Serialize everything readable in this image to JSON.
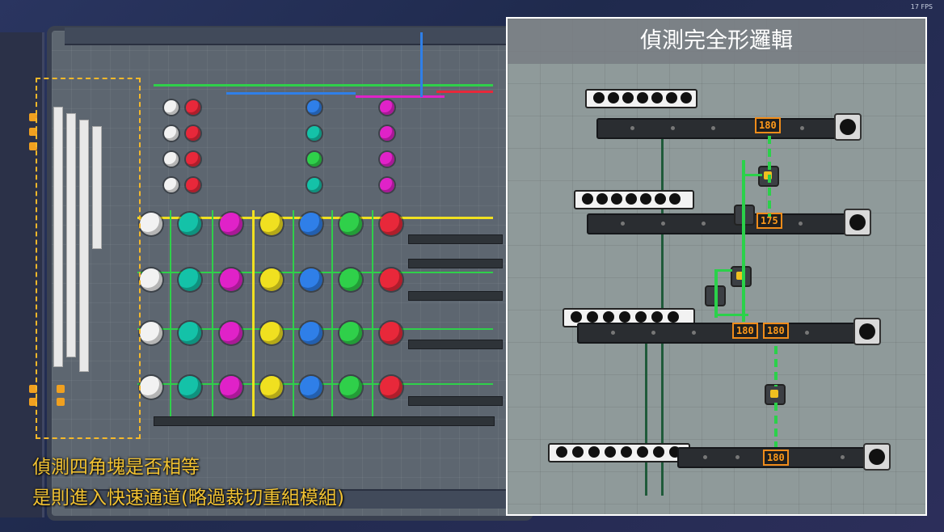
{
  "hud": {
    "fps": "17 FPS"
  },
  "inset": {
    "title": "偵測完全形邏輯",
    "counters": [
      "180",
      "175",
      "180",
      "180",
      "180"
    ],
    "partial_counter": "180"
  },
  "caption": {
    "line1": "偵測四角塊是否相等",
    "line2": "是則進入快速通道(略過裁切重組模組)"
  },
  "colors": {
    "white": "#f2f2f2",
    "cyan": "#14c2a8",
    "magenta": "#e022c8",
    "yellow": "#f0e020",
    "blue": "#2f7fe8",
    "green": "#2fd04a",
    "red": "#e8283a",
    "annotation": "#f1c232"
  }
}
